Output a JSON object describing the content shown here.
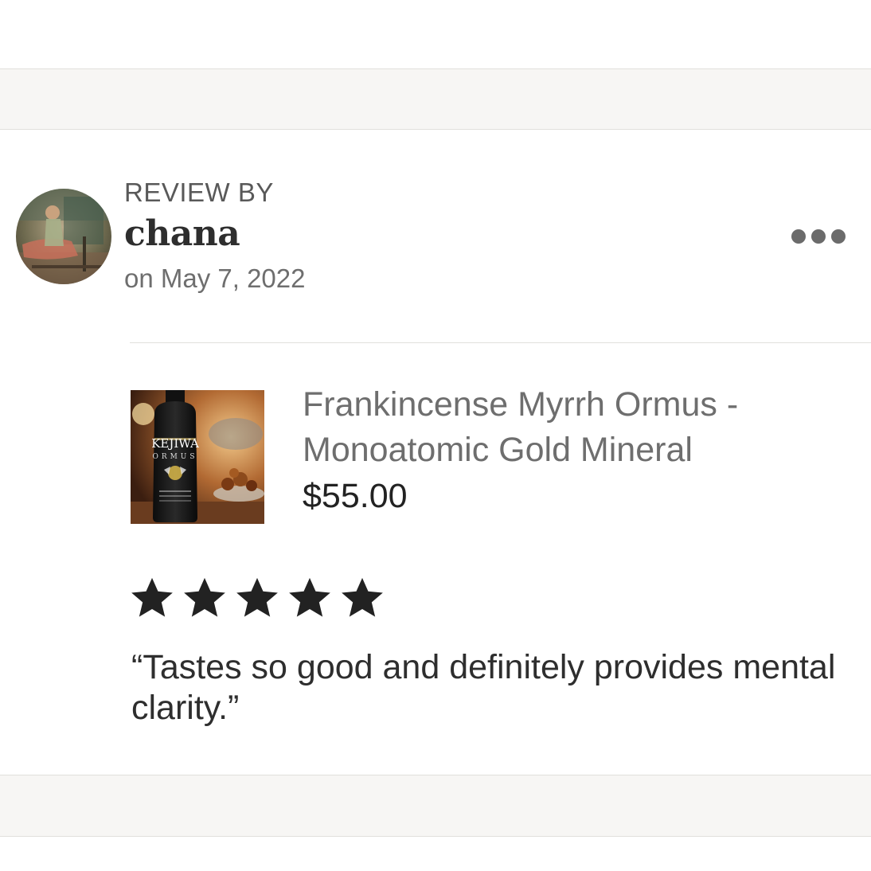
{
  "review": {
    "label": "REVIEW BY",
    "reviewer": "chana",
    "date": "on May 7, 2022",
    "rating": 5,
    "rating_max": 5,
    "text": "“Tastes so good and definitely provides mental clarity.”"
  },
  "product": {
    "title": "Frankincense Myrrh Ormus - Monoatomic Gold Mineral",
    "price": "$55.00",
    "image_brand": "KEJIWA",
    "image_sub": "ORMUS"
  },
  "icons": {
    "more": "more-options-icon",
    "star": "star-icon"
  },
  "colors": {
    "band": "#f7f6f4",
    "star": "#222222",
    "muted_text": "#6e6e6e"
  }
}
